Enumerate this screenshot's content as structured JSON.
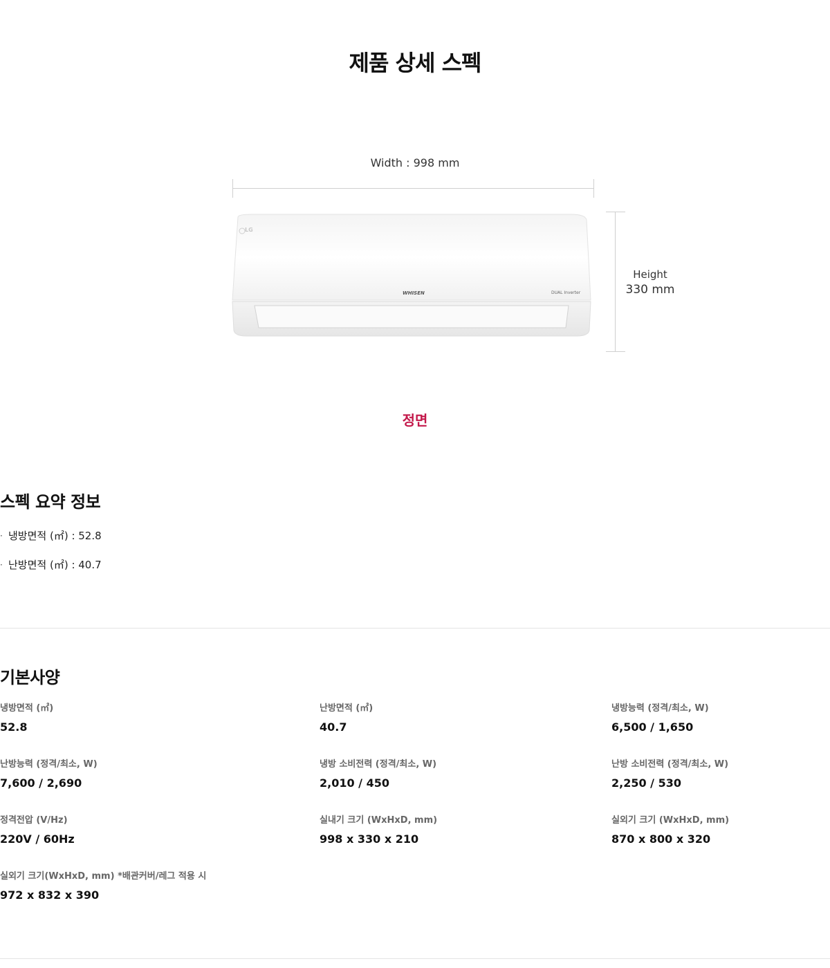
{
  "page_title": "제품 상세 스펙",
  "diagram": {
    "width_label": "Width : 998 mm",
    "height_label": "Height",
    "height_value": "330 mm",
    "brand_logo": "LG",
    "product_logo": "WHISEN",
    "product_badge": "DUAL Inverter",
    "view_label": "정면"
  },
  "summary": {
    "title": "스펙 요약 정보",
    "items": [
      "냉방면적 (㎡) : 52.8",
      "난방면적 (㎡) : 40.7"
    ]
  },
  "specs": {
    "title": "기본사양",
    "items": [
      {
        "label": "냉방면적 (㎡)",
        "value": "52.8"
      },
      {
        "label": "난방면적 (㎡)",
        "value": "40.7"
      },
      {
        "label": "냉방능력 (정격/최소, W)",
        "value": "6,500 / 1,650"
      },
      {
        "label": "난방능력 (정격/최소, W)",
        "value": "7,600 / 2,690"
      },
      {
        "label": "냉방 소비전력 (정격/최소, W)",
        "value": "2,010 / 450"
      },
      {
        "label": "난방 소비전력 (정격/최소, W)",
        "value": "2,250 / 530"
      },
      {
        "label": "정격전압 (V/Hz)",
        "value": "220V / 60Hz"
      },
      {
        "label": "실내기 크기 (WxHxD, mm)",
        "value": "998 x 330 x 210"
      },
      {
        "label": "실외기 크기 (WxHxD, mm)",
        "value": "870 x 800 x 320"
      },
      {
        "label": "실외기 크기(WxHxD, mm) *배관커버/레그 적용 시",
        "value": "972 x 832 x 390"
      }
    ]
  }
}
